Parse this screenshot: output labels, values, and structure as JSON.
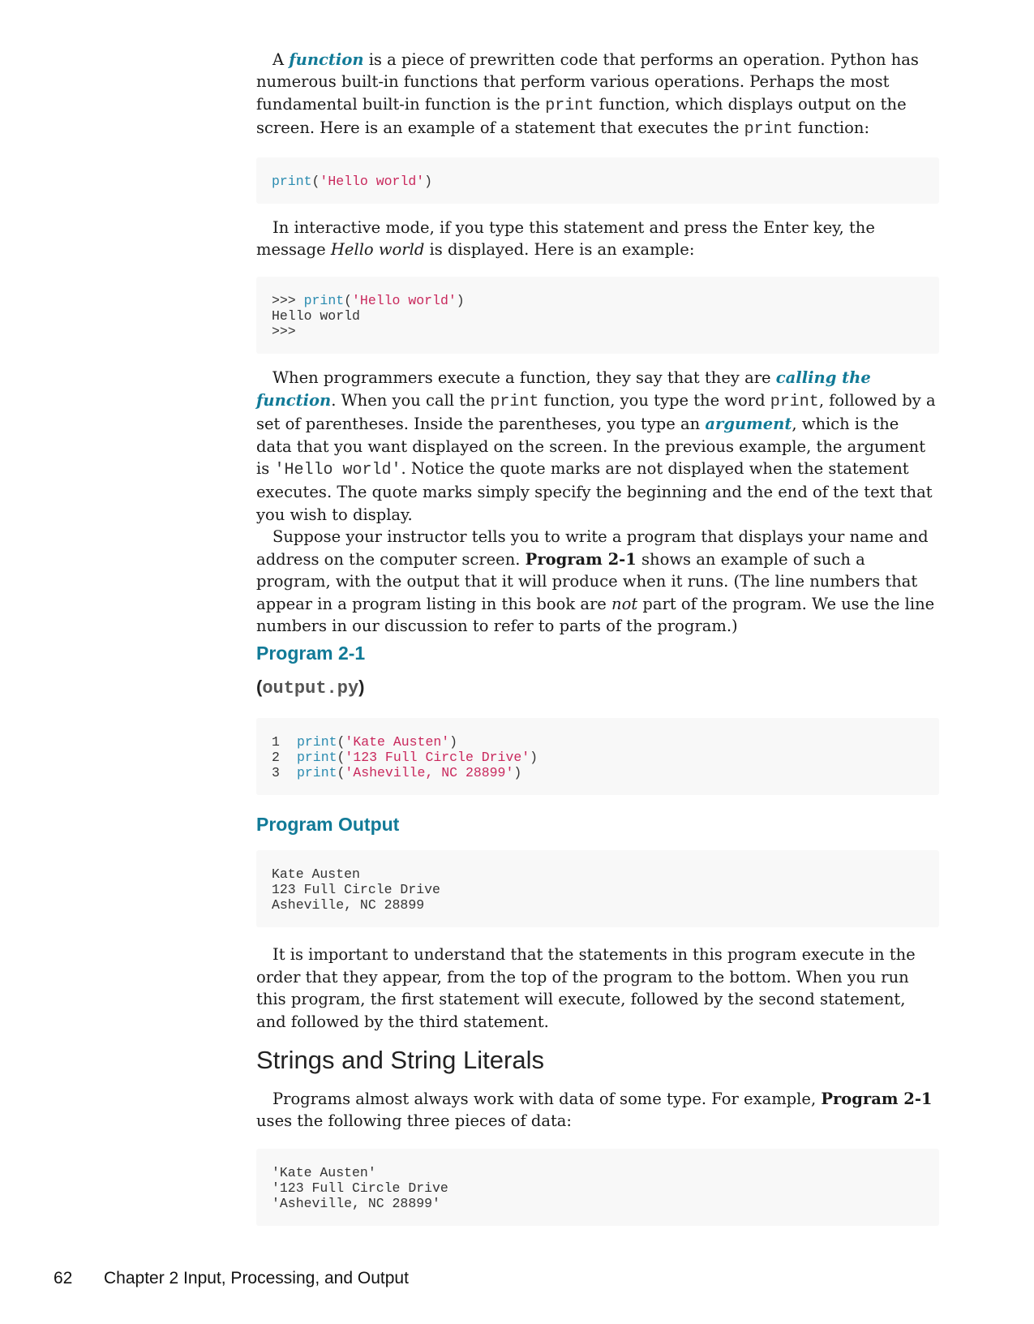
{
  "para1": {
    "t1": "A ",
    "term": "function",
    "t2": " is a piece of prewritten code that performs an operation. Python has numerous built-in functions that perform various operations. Perhaps the most fundamental built-in function is the ",
    "code1": "print",
    "t3": " function, which displays output on the screen. Here is an example of a statement that executes the ",
    "code2": "print",
    "t4": " function:"
  },
  "code1": {
    "kw": "print",
    "p1": "(",
    "str": "'Hello world'",
    "p2": ")"
  },
  "para2": {
    "t1": "In interactive mode, if you type this statement and press the Enter key, the message ",
    "em": "Hello world",
    "t2": " is displayed. Here is an example:"
  },
  "code2": {
    "prompt1": ">>> ",
    "kw": "print",
    "p1": "(",
    "str": "'Hello world'",
    "p2": ")",
    "output": "Hello world",
    "prompt2": ">>>"
  },
  "para3": {
    "t1": "When programmers execute a function, they say that they are ",
    "term1": "calling the function",
    "t2": ". When you call the ",
    "code1": "print",
    "t3": " function, you type the word ",
    "code2": "print",
    "t4": ", followed by a set of parentheses. Inside the parentheses, you type an ",
    "term2": "argument",
    "t5": ", which is the data that you want displayed on the screen. In the previous example, the argument is ",
    "code3": "'Hello world'",
    "t6": ". Notice the quote marks are not displayed when the statement executes. The quote marks simply specify the beginning and the end of the text that you wish to display."
  },
  "para4": {
    "t1": "Suppose your instructor tells you to write a program that displays your name and address on the computer screen. ",
    "strong": "Program 2-1",
    "t2": " shows an example of such a program, with the output that it will produce when it runs. (The line numbers that appear in a program listing in this book are ",
    "em": "not",
    "t3": " part of the program. We use the line numbers in our discussion to refer to parts of the program.)"
  },
  "program_heading": "Program 2-1",
  "program_filename": {
    "open": "(",
    "name": "output.py",
    "close": ")"
  },
  "program_lines": [
    {
      "num": "1",
      "kw": "print",
      "p1": "(",
      "str": "'Kate Austen'",
      "p2": ")"
    },
    {
      "num": "2",
      "kw": "print",
      "p1": "(",
      "str": "'123 Full Circle Drive'",
      "p2": ")"
    },
    {
      "num": "3",
      "kw": "print",
      "p1": "(",
      "str": "'Asheville, NC 28899'",
      "p2": ")"
    }
  ],
  "output_heading": "Program Output",
  "output_lines": [
    "Kate Austen",
    "123 Full Circle Drive",
    "Asheville, NC 28899"
  ],
  "para5": "It is important to understand that the statements in this program execute in the order that they appear, from the top of the program to the bottom. When you run this program, the first statement will execute, followed by the second statement, and followed by the third statement.",
  "section_heading": "Strings and String Literals",
  "para6": {
    "t1": "Programs almost always work with data of some type. For example, ",
    "strong": "Program 2-1",
    "t2": " uses the following three pieces of data:"
  },
  "data_lines": [
    "'Kate Austen'",
    "'123 Full Circle Drive",
    "'Asheville, NC 28899'"
  ],
  "footer": {
    "page_number": "62",
    "chapter": "Chapter 2 Input, Processing, and Output"
  },
  "colors": {
    "term": "#117a97",
    "keyword": "#2a8bb0",
    "string": "#c9285c",
    "code_bg": "#f8f8f8"
  }
}
